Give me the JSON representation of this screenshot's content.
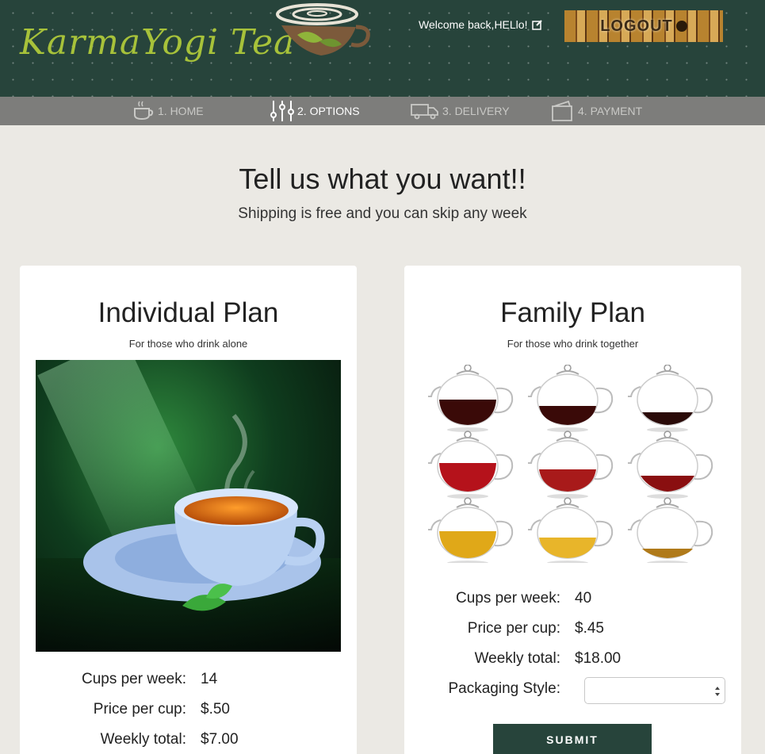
{
  "brand": {
    "name": "KarmaYogi Tea"
  },
  "header": {
    "welcome": "Welcome back,HELlo!",
    "logout_label": "LOGOUT"
  },
  "steps": [
    {
      "label": "1. HOME",
      "icon": "teacup-icon",
      "active": false
    },
    {
      "label": "2. OPTIONS",
      "icon": "sliders-icon",
      "active": true
    },
    {
      "label": "3. DELIVERY",
      "icon": "truck-icon",
      "active": false
    },
    {
      "label": "4. PAYMENT",
      "icon": "wallet-icon",
      "active": false
    }
  ],
  "hero": {
    "title": "Tell us what you want!!",
    "subtitle": "Shipping is free and you can skip any week"
  },
  "individual": {
    "title": "Individual Plan",
    "subtitle": "For those who drink alone",
    "cups_label": "Cups per week:",
    "cups_value": "14",
    "price_label": "Price per cup:",
    "price_value": "$.50",
    "total_label": "Weekly total:",
    "total_value": "$7.00"
  },
  "family": {
    "title": "Family Plan",
    "subtitle": "For those who drink together",
    "cups_label": "Cups per week:",
    "cups_value": "40",
    "price_label": "Price per cup:",
    "price_value": "$.45",
    "total_label": "Weekly total:",
    "total_value": "$18.00",
    "packaging_label": "Packaging Style:",
    "packaging_value": "",
    "submit_label": "SUBMIT"
  },
  "colors": {
    "header_bg": "#27443b",
    "logo_green": "#a7c23a",
    "page_bg": "#ebe9e4",
    "steps_bg": "#7d7d7b",
    "button_bg": "#27443b"
  }
}
